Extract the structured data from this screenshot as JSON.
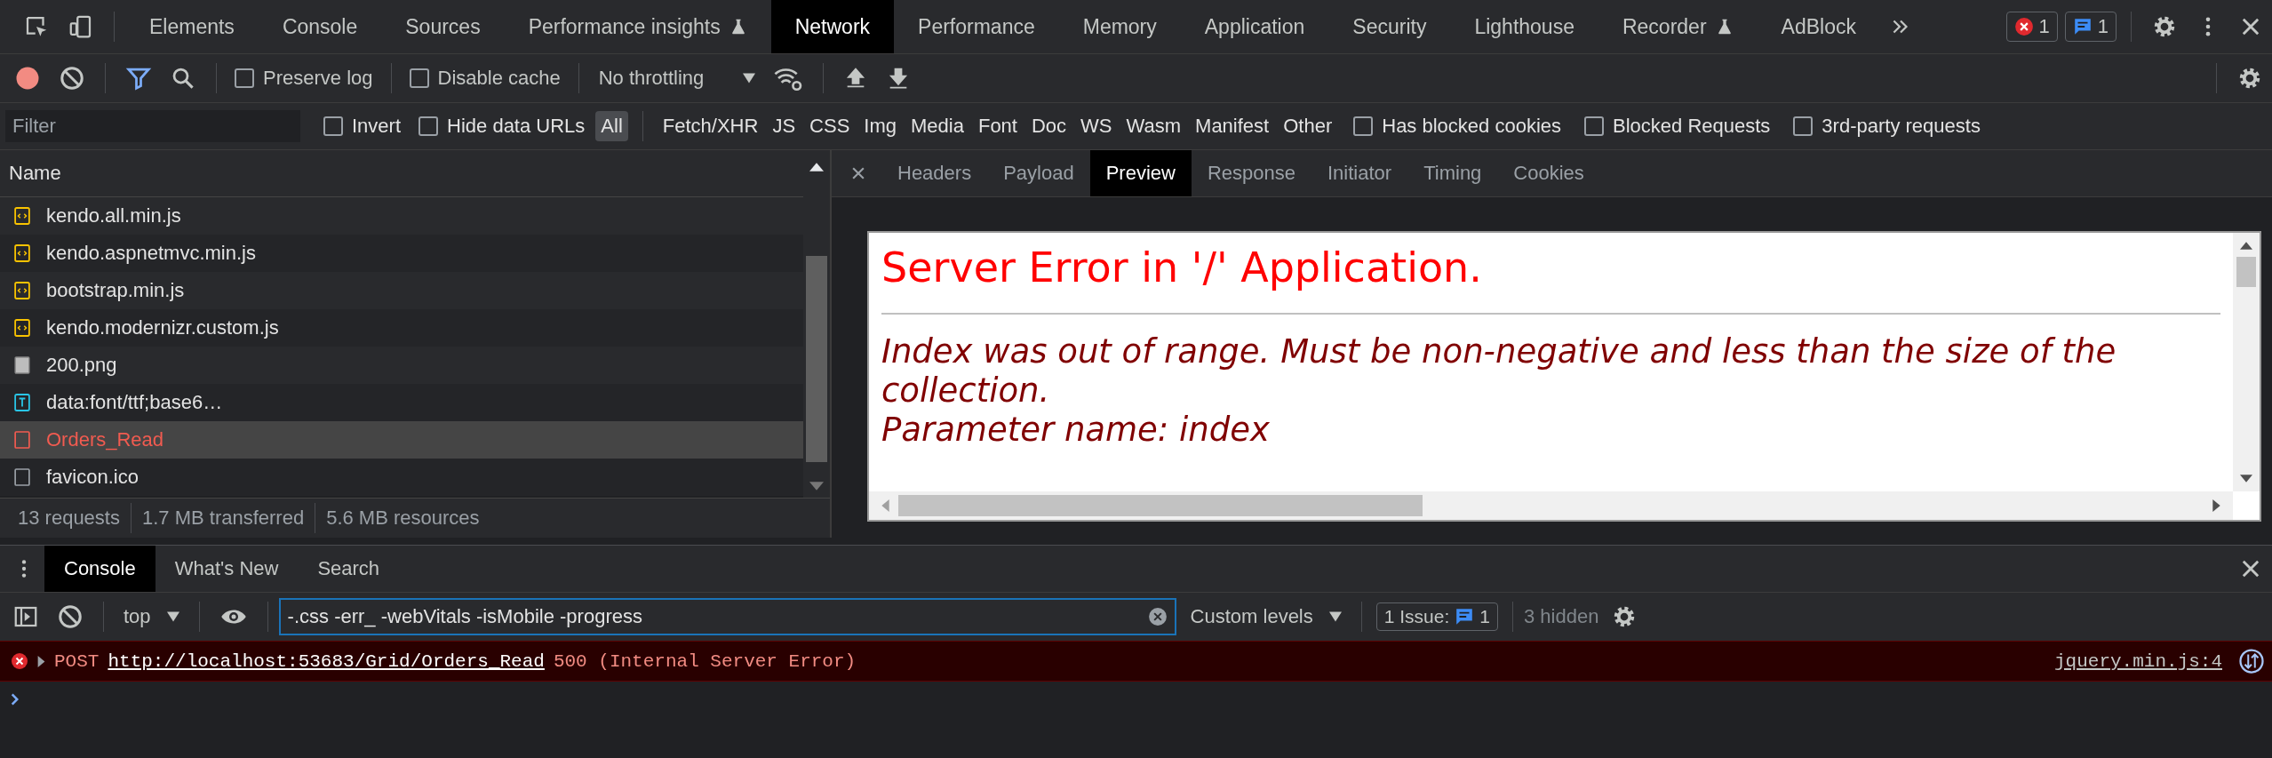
{
  "main_tabs": [
    {
      "label": "Elements",
      "selected": false,
      "experimental": false
    },
    {
      "label": "Console",
      "selected": false,
      "experimental": false
    },
    {
      "label": "Sources",
      "selected": false,
      "experimental": false
    },
    {
      "label": "Performance insights",
      "selected": false,
      "experimental": true
    },
    {
      "label": "Network",
      "selected": true,
      "experimental": false
    },
    {
      "label": "Performance",
      "selected": false,
      "experimental": false
    },
    {
      "label": "Memory",
      "selected": false,
      "experimental": false
    },
    {
      "label": "Application",
      "selected": false,
      "experimental": false
    },
    {
      "label": "Security",
      "selected": false,
      "experimental": false
    },
    {
      "label": "Lighthouse",
      "selected": false,
      "experimental": false
    },
    {
      "label": "Recorder",
      "selected": false,
      "experimental": true
    },
    {
      "label": "AdBlock",
      "selected": false,
      "experimental": false
    }
  ],
  "error_badge": "1",
  "issue_badge": "1",
  "toolbar": {
    "recording": true,
    "filter_on": true,
    "checks": [
      {
        "label": "Preserve log",
        "checked": false
      },
      {
        "label": "Disable cache",
        "checked": false
      }
    ],
    "throttling": "No throttling"
  },
  "filter": {
    "placeholder": "Filter",
    "checks_before": [
      {
        "label": "Invert",
        "checked": false
      },
      {
        "label": "Hide data URLs",
        "checked": false
      }
    ],
    "types": [
      {
        "label": "All",
        "selected": true
      },
      {
        "label": "Fetch/XHR",
        "selected": false
      },
      {
        "label": "JS",
        "selected": false
      },
      {
        "label": "CSS",
        "selected": false
      },
      {
        "label": "Img",
        "selected": false
      },
      {
        "label": "Media",
        "selected": false
      },
      {
        "label": "Font",
        "selected": false
      },
      {
        "label": "Doc",
        "selected": false
      },
      {
        "label": "WS",
        "selected": false
      },
      {
        "label": "Wasm",
        "selected": false
      },
      {
        "label": "Manifest",
        "selected": false
      },
      {
        "label": "Other",
        "selected": false
      }
    ],
    "checks_after": [
      {
        "label": "Has blocked cookies",
        "checked": false
      },
      {
        "label": "Blocked Requests",
        "checked": false
      },
      {
        "label": "3rd-party requests",
        "checked": false
      }
    ]
  },
  "requests": {
    "column": "Name",
    "rows": [
      {
        "name": "kendo.all.min.js",
        "kind": "script",
        "selected": false,
        "failed": false
      },
      {
        "name": "kendo.aspnetmvc.min.js",
        "kind": "script",
        "selected": false,
        "failed": false
      },
      {
        "name": "bootstrap.min.js",
        "kind": "script",
        "selected": false,
        "failed": false
      },
      {
        "name": "kendo.modernizr.custom.js",
        "kind": "script",
        "selected": false,
        "failed": false
      },
      {
        "name": "200.png",
        "kind": "image",
        "selected": false,
        "failed": false
      },
      {
        "name": "data:font/ttf;base6…",
        "kind": "font",
        "selected": false,
        "failed": false
      },
      {
        "name": "Orders_Read",
        "kind": "document",
        "selected": true,
        "failed": true
      },
      {
        "name": "favicon.ico",
        "kind": "document",
        "selected": false,
        "failed": false
      }
    ],
    "summary": [
      "13 requests",
      "1.7 MB transferred",
      "5.6 MB resources"
    ]
  },
  "detail_tabs": [
    {
      "label": "Headers",
      "selected": false
    },
    {
      "label": "Payload",
      "selected": false
    },
    {
      "label": "Preview",
      "selected": true
    },
    {
      "label": "Response",
      "selected": false
    },
    {
      "label": "Initiator",
      "selected": false
    },
    {
      "label": "Timing",
      "selected": false
    },
    {
      "label": "Cookies",
      "selected": false
    }
  ],
  "preview": {
    "title": "Server Error in '/' Application.",
    "message": "Index was out of range. Must be non-negative and less than the size of the collection.",
    "parameter": "Parameter name: index"
  },
  "drawer_tabs": [
    {
      "label": "Console",
      "selected": true
    },
    {
      "label": "What's New",
      "selected": false
    },
    {
      "label": "Search",
      "selected": false
    }
  ],
  "console": {
    "context": "top",
    "filter_value": "-.css -err_ -webVitals -isMobile -progress",
    "levels": "Custom levels",
    "issues_label": "1 Issue:",
    "issues_count": "1",
    "hidden": "3 hidden",
    "messages": [
      {
        "kind": "error",
        "method": "POST",
        "url": "http://localhost:53683/Grid/Orders_Read",
        "status": "500 (Internal Server Error)",
        "source": "jquery.min.js:4"
      }
    ]
  }
}
